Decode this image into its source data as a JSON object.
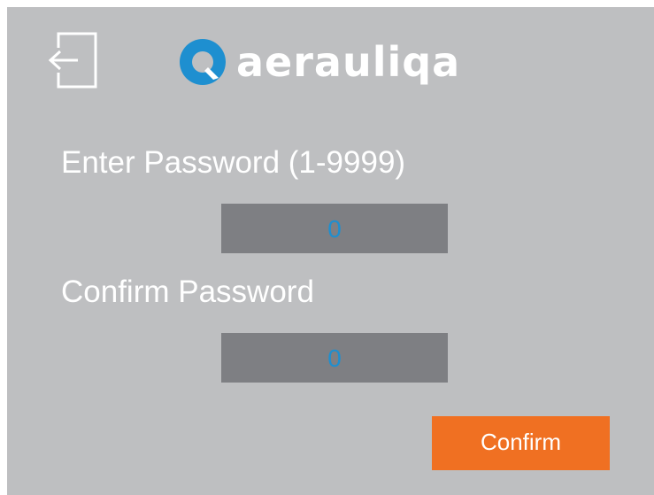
{
  "header": {
    "exit_icon": "logout-icon",
    "logo_text": "aerauliqa",
    "brand_color": "#1e8fd0"
  },
  "form": {
    "password_label": "Enter Password (1-9999)",
    "password_value": "0",
    "confirm_label": "Confirm Password",
    "confirm_value": "0"
  },
  "actions": {
    "confirm_label": "Confirm",
    "confirm_color": "#f07022"
  }
}
